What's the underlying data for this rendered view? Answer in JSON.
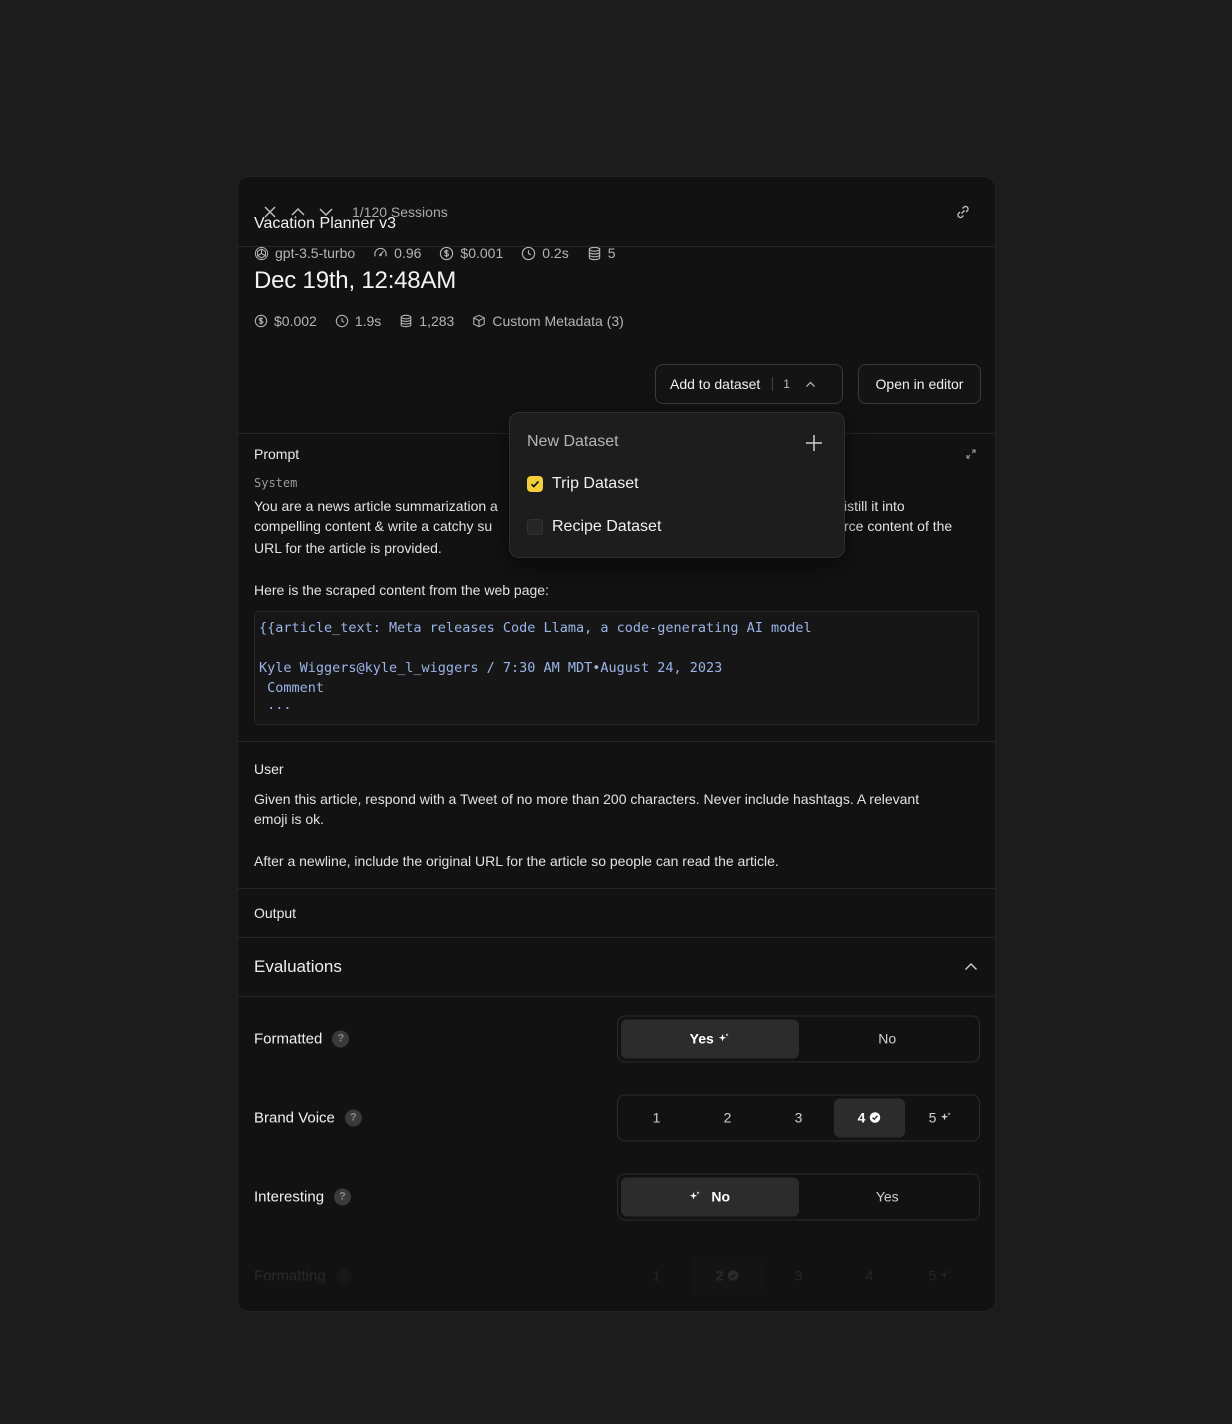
{
  "topbar": {
    "sessions": "1/120 Sessions"
  },
  "session": {
    "title": "Dec 19th, 12:48AM",
    "cost": "$0.002",
    "latency": "1.9s",
    "tokens": "1,283",
    "metadata": "Custom Metadata (3)"
  },
  "run": {
    "name": "Vacation Planner v3",
    "model": "gpt-3.5-turbo",
    "score": "0.96",
    "cost": "$0.001",
    "latency": "0.2s",
    "tokens": "5",
    "add_label": "Add to dataset",
    "add_count": "1",
    "open_label": "Open in editor"
  },
  "dropdown": {
    "new_label": "New Dataset",
    "items": [
      {
        "label": "Trip Dataset",
        "checked": true
      },
      {
        "label": "Recipe Dataset",
        "checked": false
      }
    ]
  },
  "prompt": {
    "heading": "Prompt",
    "system_label": "System",
    "line1_a": "You are a news article summarization a",
    "line1_b": "istill it into",
    "line2_a": "compelling content & write a catchy su",
    "line2_b": "rce content of the",
    "line3": "URL for the article is provided.",
    "scraped": "Here is the scraped content from the web page:",
    "code": [
      "{{article_text: Meta releases Code Llama, a code-generating AI model",
      "",
      "Kyle Wiggers@kyle_l_wiggers / 7:30 AM MDT•August 24, 2023",
      " Comment",
      " ..."
    ]
  },
  "user": {
    "heading": "User",
    "para1_l1": "Given this article, respond with a Tweet of no more than 200 characters. Never include hashtags. A relevant",
    "para1_l2": "emoji is ok.",
    "para2": "After a newline, include the original URL for the article so people can read the article."
  },
  "output": {
    "heading": "Output"
  },
  "evaluations": {
    "heading": "Evaluations",
    "rows": [
      {
        "label": "Formatted",
        "options": [
          "Yes",
          "No"
        ],
        "selected": 0
      },
      {
        "label": "Brand Voice",
        "options": [
          "1",
          "2",
          "3",
          "4",
          "5"
        ],
        "selected": 3
      },
      {
        "label": "Interesting",
        "options": [
          "No",
          "Yes"
        ],
        "selected": 0
      },
      {
        "label": "Formatting",
        "options": [
          "1",
          "2",
          "3",
          "4",
          "5"
        ],
        "selected": 1
      }
    ]
  }
}
